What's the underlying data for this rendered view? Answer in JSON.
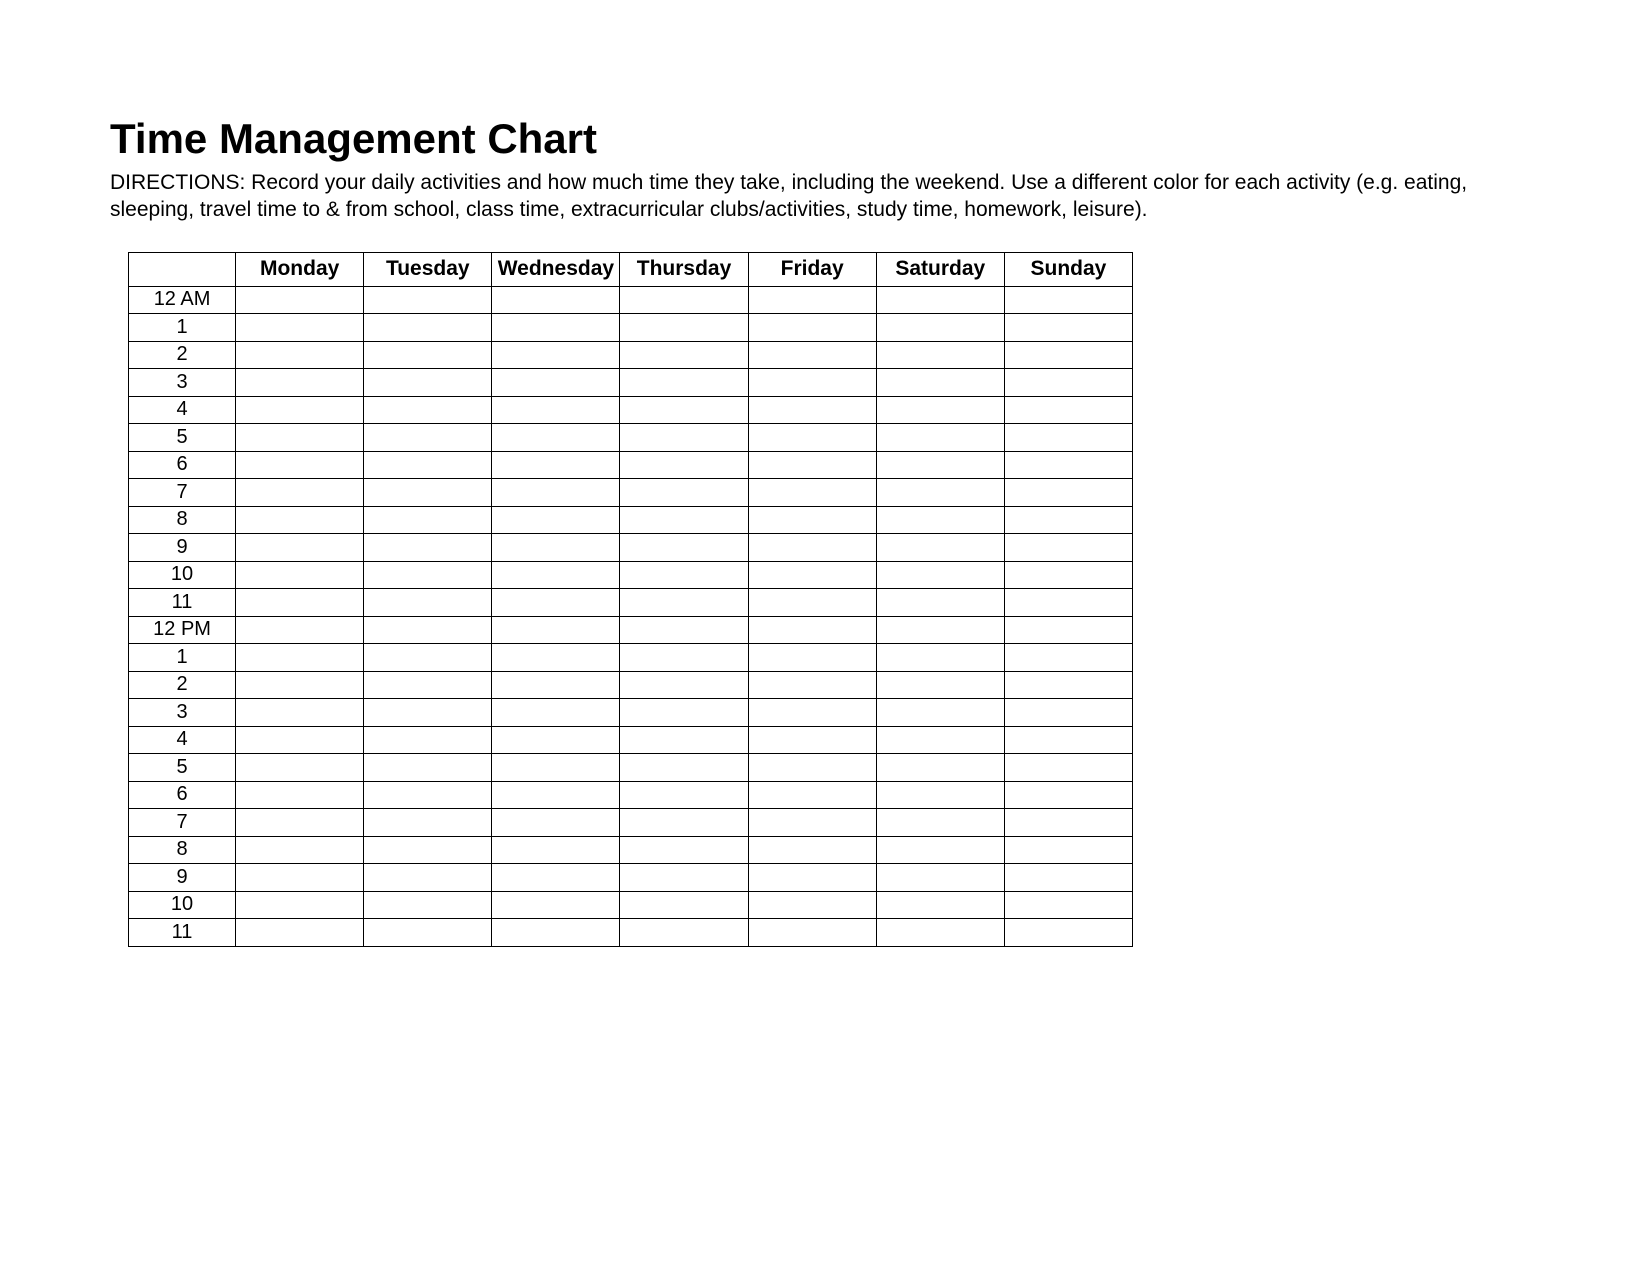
{
  "title": "Time Management Chart",
  "directions": "DIRECTIONS: Record your daily activities and how much time they take, including the weekend. Use a different color for each activity (e.g. eating, sleeping, travel time to & from school, class time, extracurricular clubs/activities, study time, homework, leisure).",
  "days": [
    "Monday",
    "Tuesday",
    "Wednesday",
    "Thursday",
    "Friday",
    "Saturday",
    "Sunday"
  ],
  "hours": [
    "12 AM",
    "1",
    "2",
    "3",
    "4",
    "5",
    "6",
    "7",
    "8",
    "9",
    "10",
    "11",
    "12 PM",
    "1",
    "2",
    "3",
    "4",
    "5",
    "6",
    "7",
    "8",
    "9",
    "10",
    "11"
  ]
}
